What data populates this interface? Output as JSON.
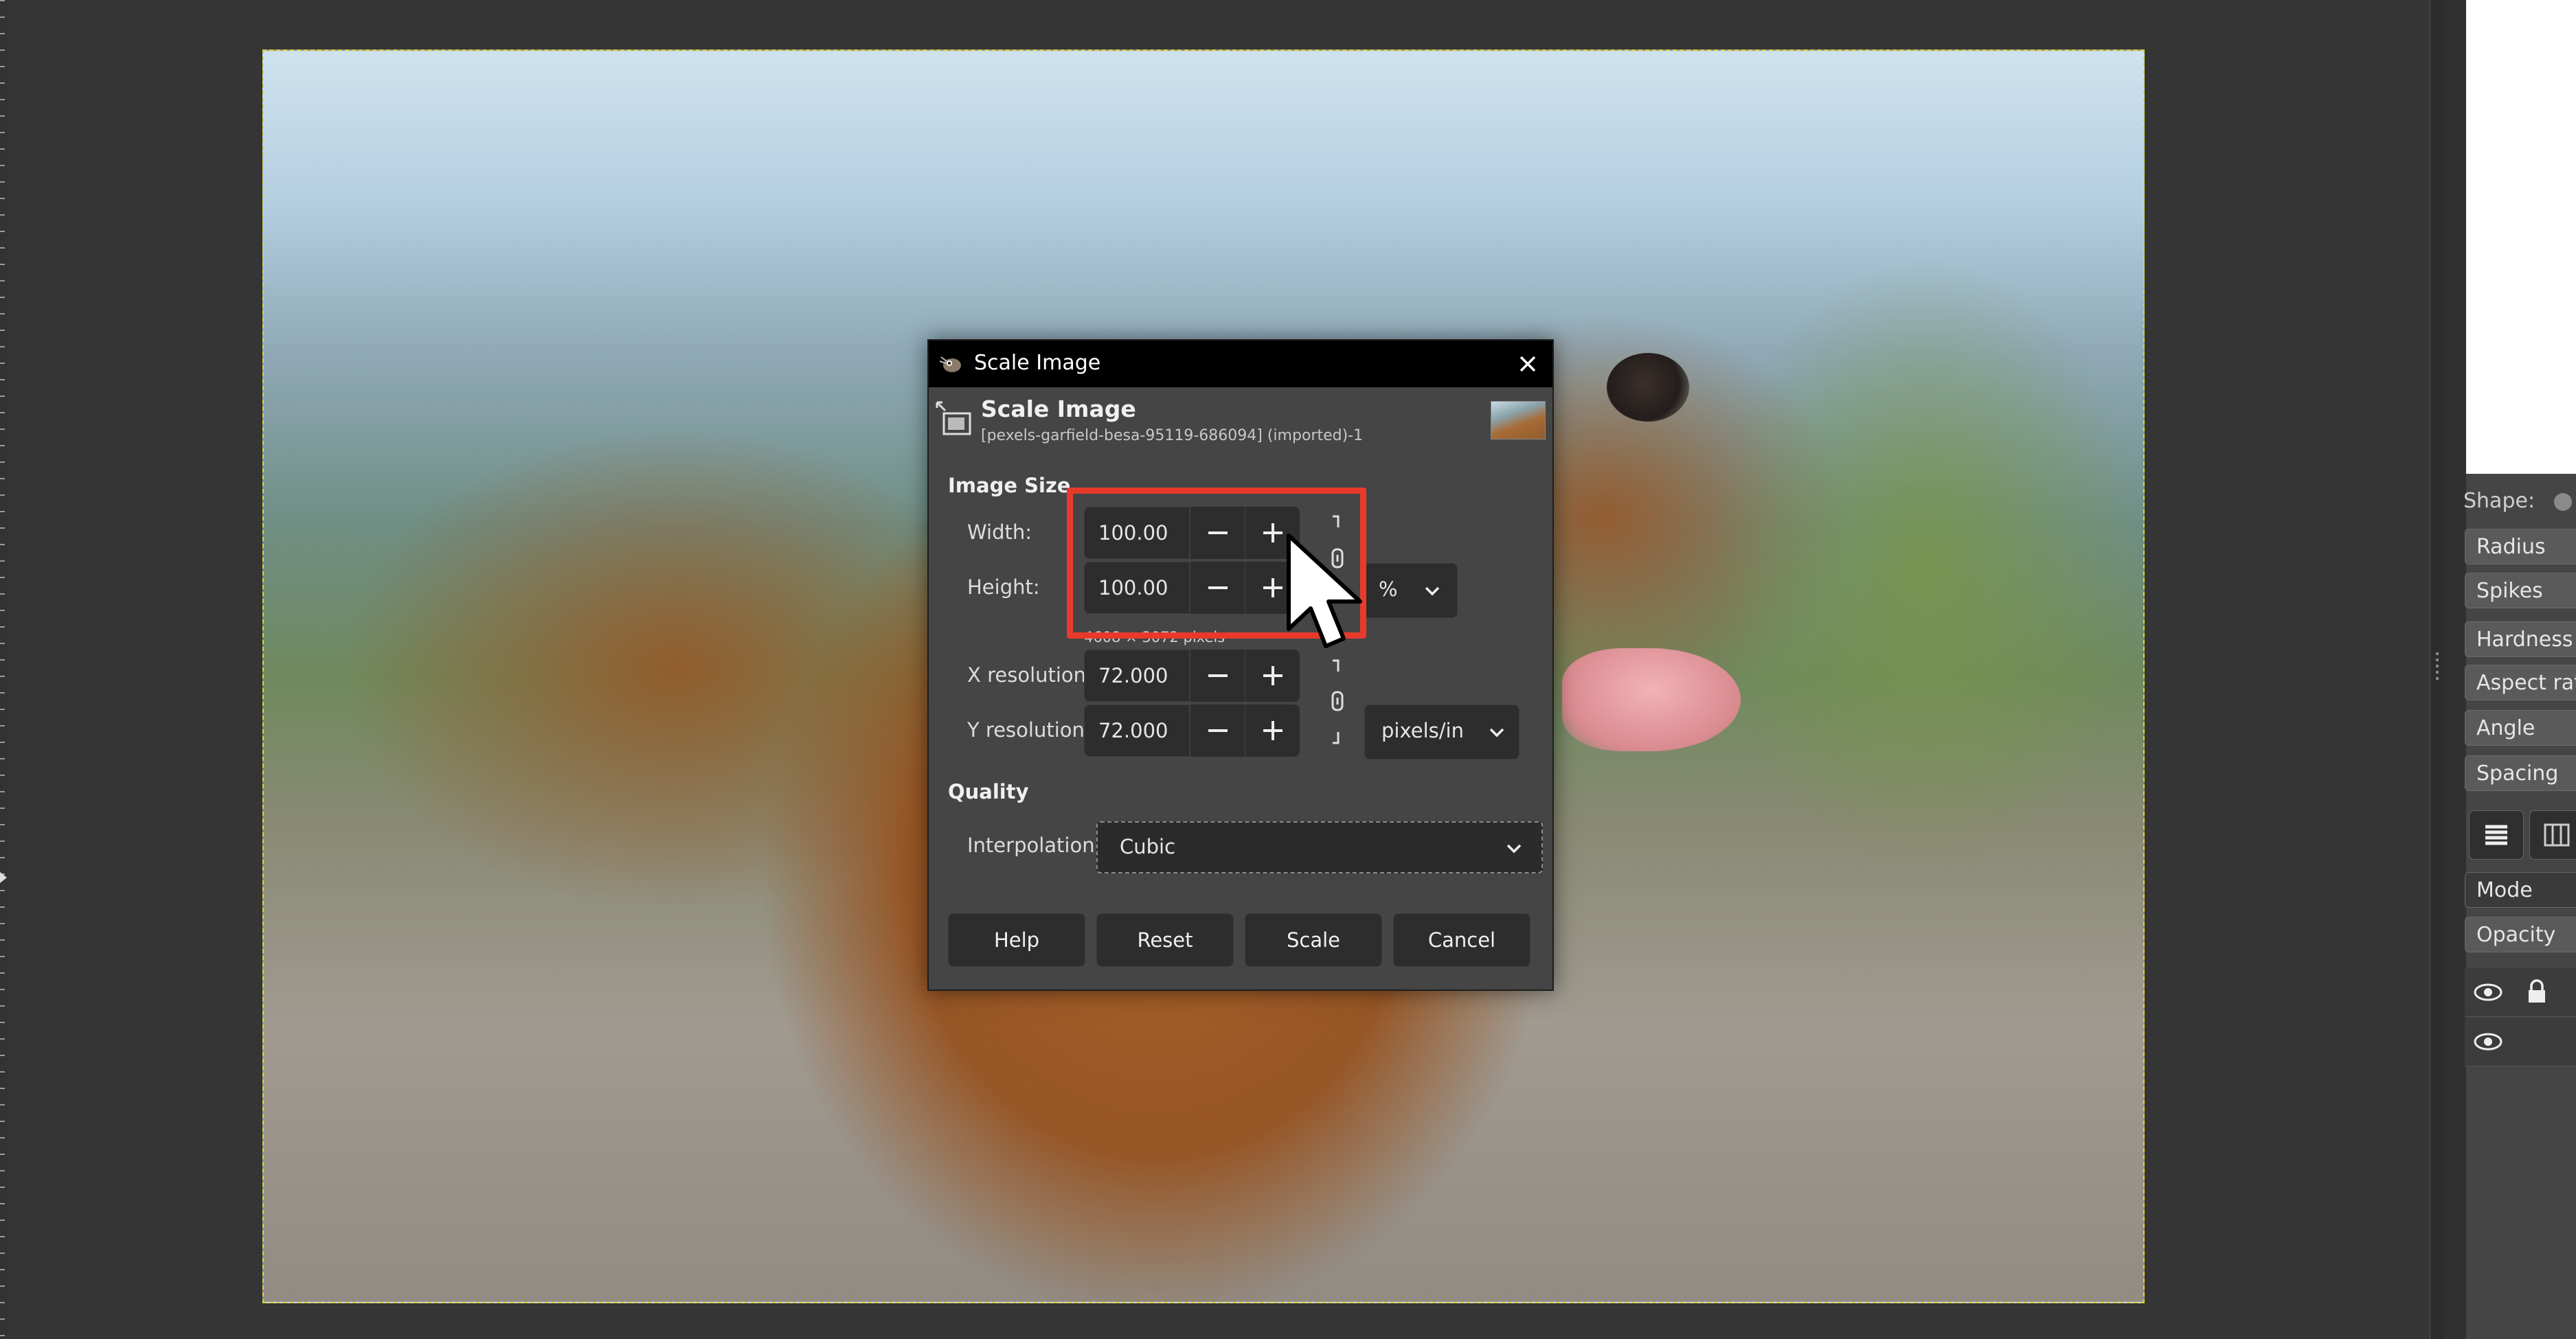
{
  "dialog": {
    "window_title": "Scale Image",
    "header_title": "Scale Image",
    "header_subtitle": "[pexels-garfield-besa-95119-686094] (imported)-1",
    "image_size_section": "Image Size",
    "width_label": "Width:",
    "width_value": "100.00",
    "height_label": "Height:",
    "height_value": "100.00",
    "size_unit": "%",
    "pixels_note": "4608 × 3072 pixels",
    "xres_label": "X resolution:",
    "xres_value": "72.000",
    "yres_label": "Y resolution:",
    "yres_value": "72.000",
    "res_unit": "pixels/in",
    "quality_section": "Quality",
    "interp_label": "Interpolation:",
    "interp_value": "Cubic",
    "buttons": {
      "help": "Help",
      "reset": "Reset",
      "scale": "Scale",
      "cancel": "Cancel"
    }
  },
  "tool_options": {
    "shape_label": "Shape:",
    "items": [
      "Radius",
      "Spikes",
      "Hardness",
      "Aspect ratio",
      "Angle",
      "Spacing"
    ]
  },
  "layers": {
    "mode_label": "Mode",
    "opacity_label": "Opacity"
  },
  "colors": {
    "highlight": "#e83a2a",
    "dialog_bg": "#454545",
    "field_bg": "#2d2d2d",
    "selection_border": "#e0d33a"
  }
}
